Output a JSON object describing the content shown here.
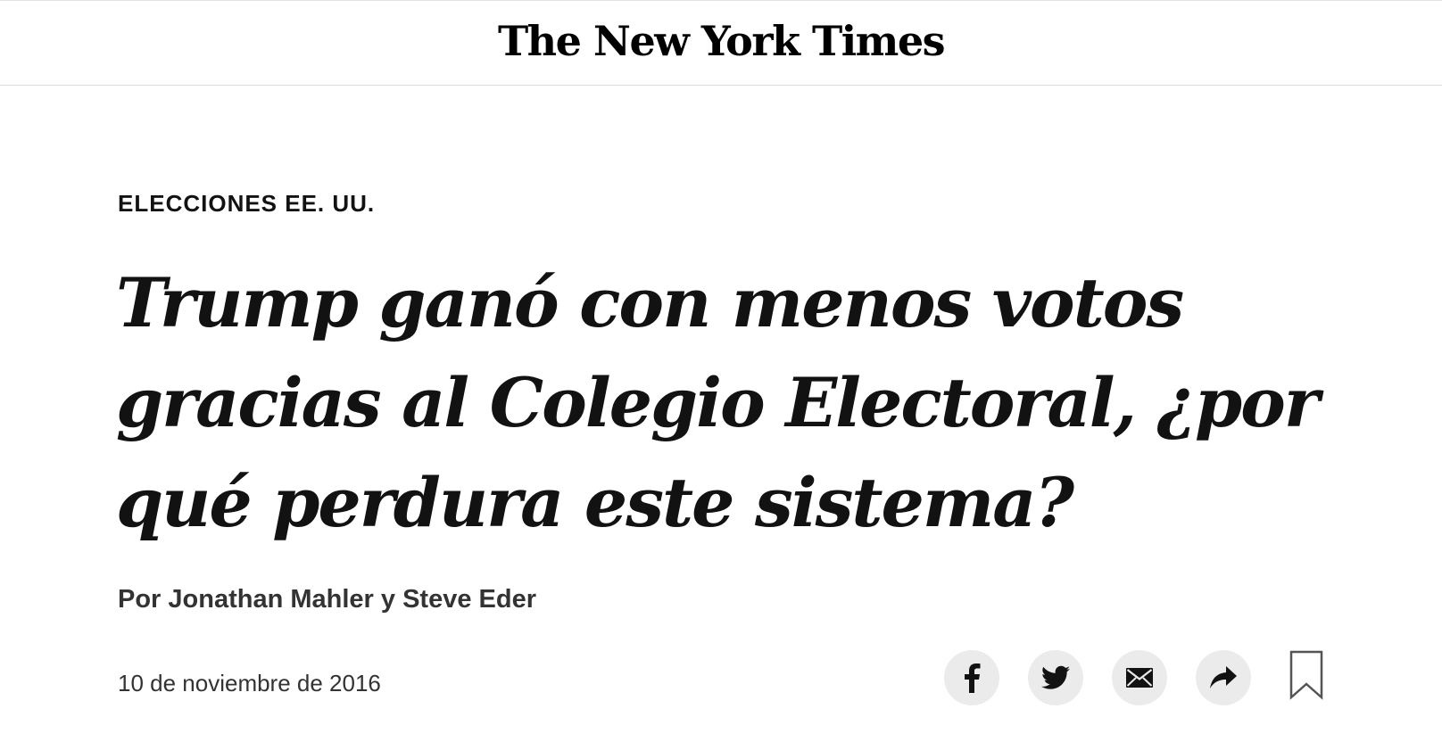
{
  "masthead": {
    "logo_text": "The New York Times"
  },
  "article": {
    "kicker": "ELECCIONES EE. UU.",
    "headline": "Trump ganó con menos votos gracias al Colegio Electoral, ¿por qué perdura este sistema?",
    "byline": "Por Jonathan Mahler y Steve Eder",
    "date": "10 de noviembre de 2016"
  },
  "share_tools": {
    "buttons": [
      {
        "name": "facebook",
        "icon": "facebook-icon"
      },
      {
        "name": "twitter",
        "icon": "twitter-icon"
      },
      {
        "name": "email",
        "icon": "email-icon"
      },
      {
        "name": "share",
        "icon": "share-arrow-icon"
      },
      {
        "name": "save",
        "icon": "bookmark-icon"
      }
    ]
  },
  "colors": {
    "text": "#121212",
    "meta_text": "#333333",
    "share_button_bg": "#ebebeb",
    "rule": "#dcdcdc"
  }
}
